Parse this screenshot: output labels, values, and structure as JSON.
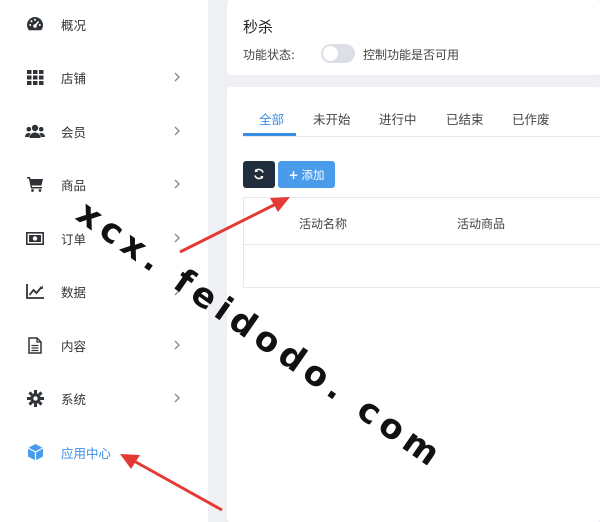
{
  "sidebar": {
    "items": [
      {
        "label": "概况",
        "icon": "dashboard-gauge-icon",
        "has_chevron": false
      },
      {
        "label": "店铺",
        "icon": "grid-icon",
        "has_chevron": true
      },
      {
        "label": "会员",
        "icon": "users-icon",
        "has_chevron": true
      },
      {
        "label": "商品",
        "icon": "cart-icon",
        "has_chevron": true
      },
      {
        "label": "订单",
        "icon": "money-bill-icon",
        "has_chevron": true
      },
      {
        "label": "数据",
        "icon": "line-chart-icon",
        "has_chevron": true
      },
      {
        "label": "内容",
        "icon": "document-icon",
        "has_chevron": true
      },
      {
        "label": "系统",
        "icon": "gear-icon",
        "has_chevron": true
      },
      {
        "label": "应用中心",
        "icon": "cube-icon",
        "has_chevron": false,
        "active": true
      }
    ]
  },
  "header_card": {
    "title": "秒杀",
    "status_label": "功能状态:",
    "toggle_on": false,
    "hint": "控制功能是否可用"
  },
  "tabs": [
    {
      "label": "全部",
      "active": true
    },
    {
      "label": "未开始"
    },
    {
      "label": "进行中"
    },
    {
      "label": "已结束"
    },
    {
      "label": "已作废"
    }
  ],
  "toolbar": {
    "refresh_icon": "refresh-icon",
    "add_label": "添加",
    "add_icon": "plus-icon"
  },
  "table": {
    "columns": [
      "活动名称",
      "活动商品"
    ]
  },
  "watermark": "xcx. feidodo. com",
  "colors": {
    "accent": "#3a8ee6",
    "dark_button": "#1f2d3d",
    "add_button": "#4a9bea",
    "annotation_arrow": "#e53935",
    "background": "#eef0f3"
  }
}
